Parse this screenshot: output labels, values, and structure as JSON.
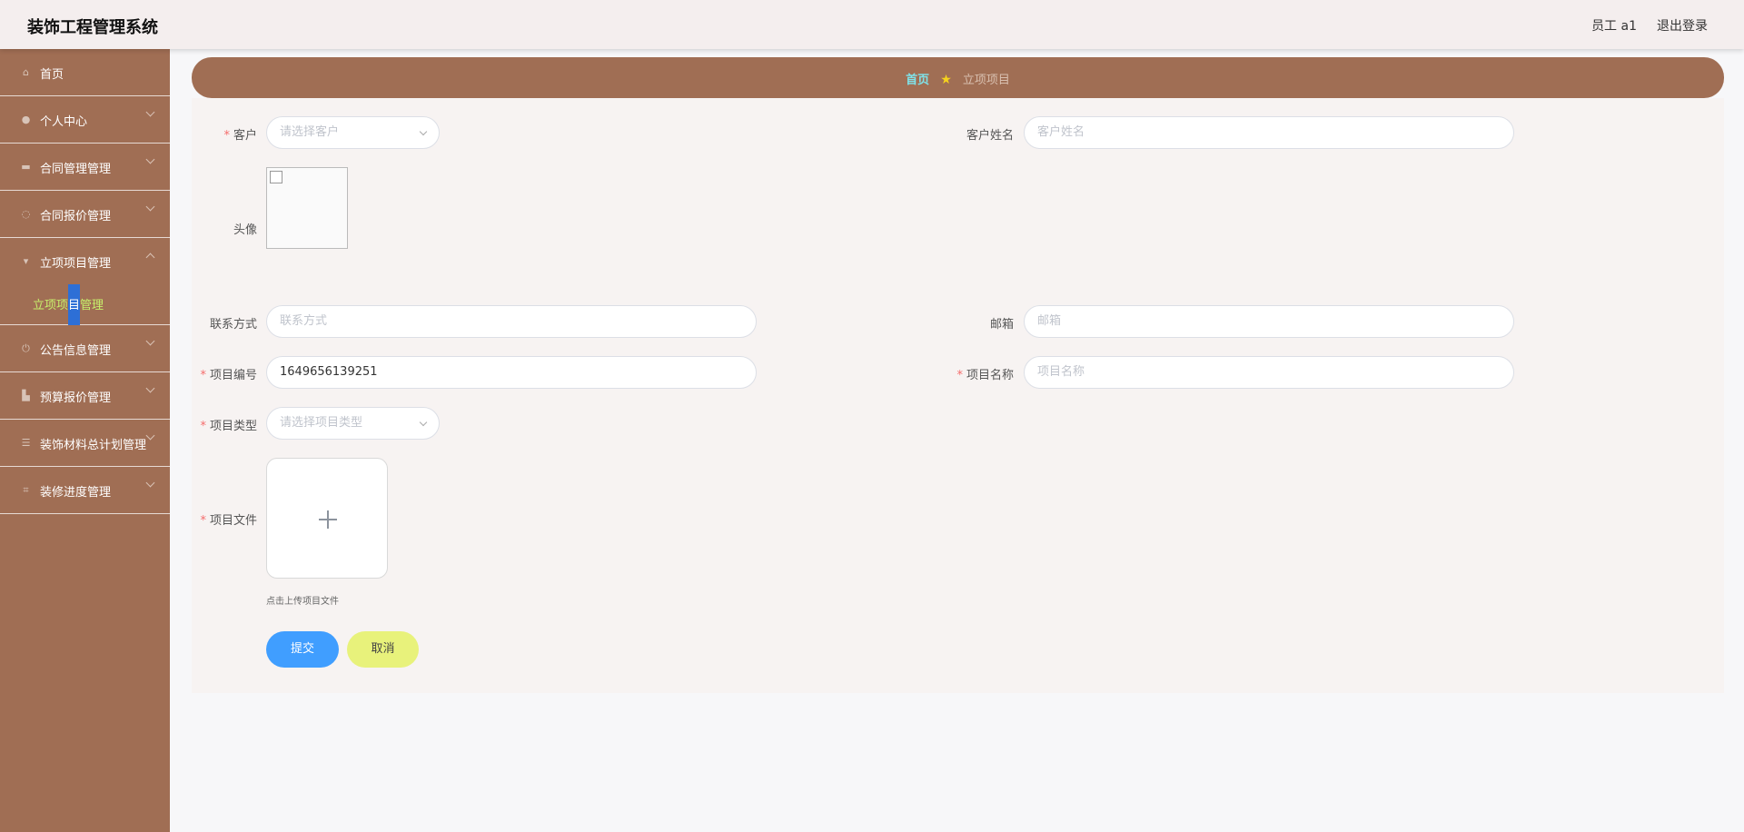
{
  "header": {
    "title": "装饰工程管理系统",
    "user": "员工 a1",
    "logout": "退出登录"
  },
  "sidebar": {
    "items": [
      {
        "label": "首页",
        "icon": "home-icon"
      },
      {
        "label": "个人中心",
        "icon": "user-icon"
      },
      {
        "label": "合同管理管理",
        "icon": "briefcase-icon"
      },
      {
        "label": "合同报价管理",
        "icon": "dotted-circle-icon"
      },
      {
        "label": "立项项目管理",
        "icon": "pin-icon",
        "sub": "立项项目管理"
      },
      {
        "label": "公告信息管理",
        "icon": "power-icon"
      },
      {
        "label": "预算报价管理",
        "icon": "thumb-icon"
      },
      {
        "label": "装饰材料总计划管理",
        "icon": "sliders-icon"
      },
      {
        "label": "装修进度管理",
        "icon": "crop-icon"
      }
    ],
    "sub_parts": [
      "立项项",
      "目",
      "管理"
    ]
  },
  "breadcrumb": {
    "home": "首页",
    "current": "立项项目"
  },
  "form": {
    "customer_label": "客户",
    "customer_placeholder": "请选择客户",
    "customer_name_label": "客户姓名",
    "customer_name_placeholder": "客户姓名",
    "avatar_label": "头像",
    "contact_label": "联系方式",
    "contact_placeholder": "联系方式",
    "email_label": "邮箱",
    "email_placeholder": "邮箱",
    "project_no_label": "项目编号",
    "project_no_value": "1649656139251",
    "project_name_label": "项目名称",
    "project_name_placeholder": "项目名称",
    "project_type_label": "项目类型",
    "project_type_placeholder": "请选择项目类型",
    "project_file_label": "项目文件",
    "upload_hint": "点击上传项目文件",
    "required_mark": "*"
  },
  "buttons": {
    "submit": "提交",
    "cancel": "取消"
  },
  "colors": {
    "sidebar_bg": "#a06e54",
    "primary": "#409eff",
    "cancel": "#e8f27b",
    "required": "#f56c6c"
  }
}
